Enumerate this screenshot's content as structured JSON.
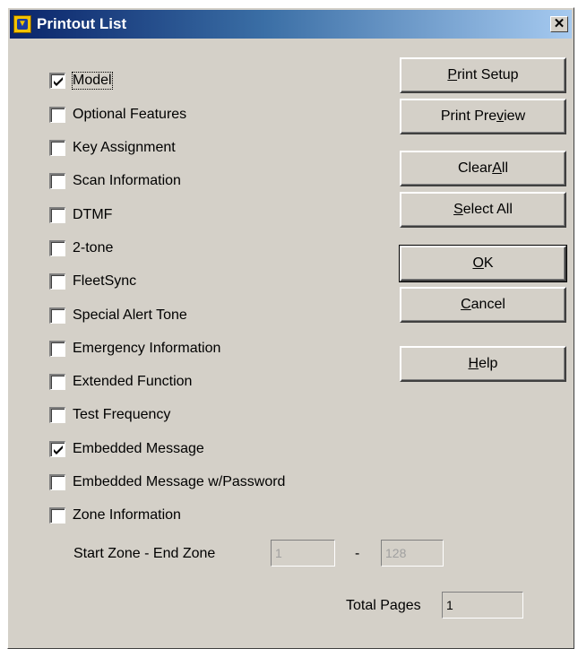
{
  "window": {
    "title": "Printout List",
    "close_glyph": "✕"
  },
  "options": [
    {
      "label": "Model",
      "checked": true
    },
    {
      "label": "Optional Features",
      "checked": false
    },
    {
      "label": "Key Assignment",
      "checked": false
    },
    {
      "label": "Scan Information",
      "checked": false
    },
    {
      "label": "DTMF",
      "checked": false
    },
    {
      "label": "2-tone",
      "checked": false
    },
    {
      "label": "FleetSync",
      "checked": false
    },
    {
      "label": "Special Alert Tone",
      "checked": false
    },
    {
      "label": "Emergency Information",
      "checked": false
    },
    {
      "label": "Extended Function",
      "checked": false
    },
    {
      "label": "Test Frequency",
      "checked": false
    },
    {
      "label": "Embedded Message",
      "checked": true
    },
    {
      "label": "Embedded Message w/Password",
      "checked": false
    },
    {
      "label": "Zone Information",
      "checked": false
    }
  ],
  "buttons": {
    "print_setup": {
      "pre": "",
      "accel": "P",
      "post": "rint Setup"
    },
    "print_preview": {
      "pre": "Print Pre",
      "accel": "v",
      "post": "iew"
    },
    "clear_all": {
      "pre": "Clear ",
      "accel": "A",
      "post": "ll"
    },
    "select_all": {
      "pre": "",
      "accel": "S",
      "post": "elect All"
    },
    "ok": {
      "pre": "",
      "accel": "O",
      "post": "K"
    },
    "cancel": {
      "pre": "",
      "accel": "C",
      "post": "ancel"
    },
    "help": {
      "pre": "",
      "accel": "H",
      "post": "elp"
    }
  },
  "zone": {
    "label": "Start Zone - End Zone",
    "start_value": "1",
    "separator": "-",
    "end_value": "128"
  },
  "total_pages": {
    "label": "Total Pages",
    "value": "1"
  },
  "colors": {
    "window_bg": "#d4d0c8",
    "title_gradient_start": "#0a246a",
    "title_gradient_end": "#a6caf0"
  },
  "icons": {
    "app": "printout-app-icon",
    "close": "close-icon",
    "check": "checkmark-icon"
  }
}
